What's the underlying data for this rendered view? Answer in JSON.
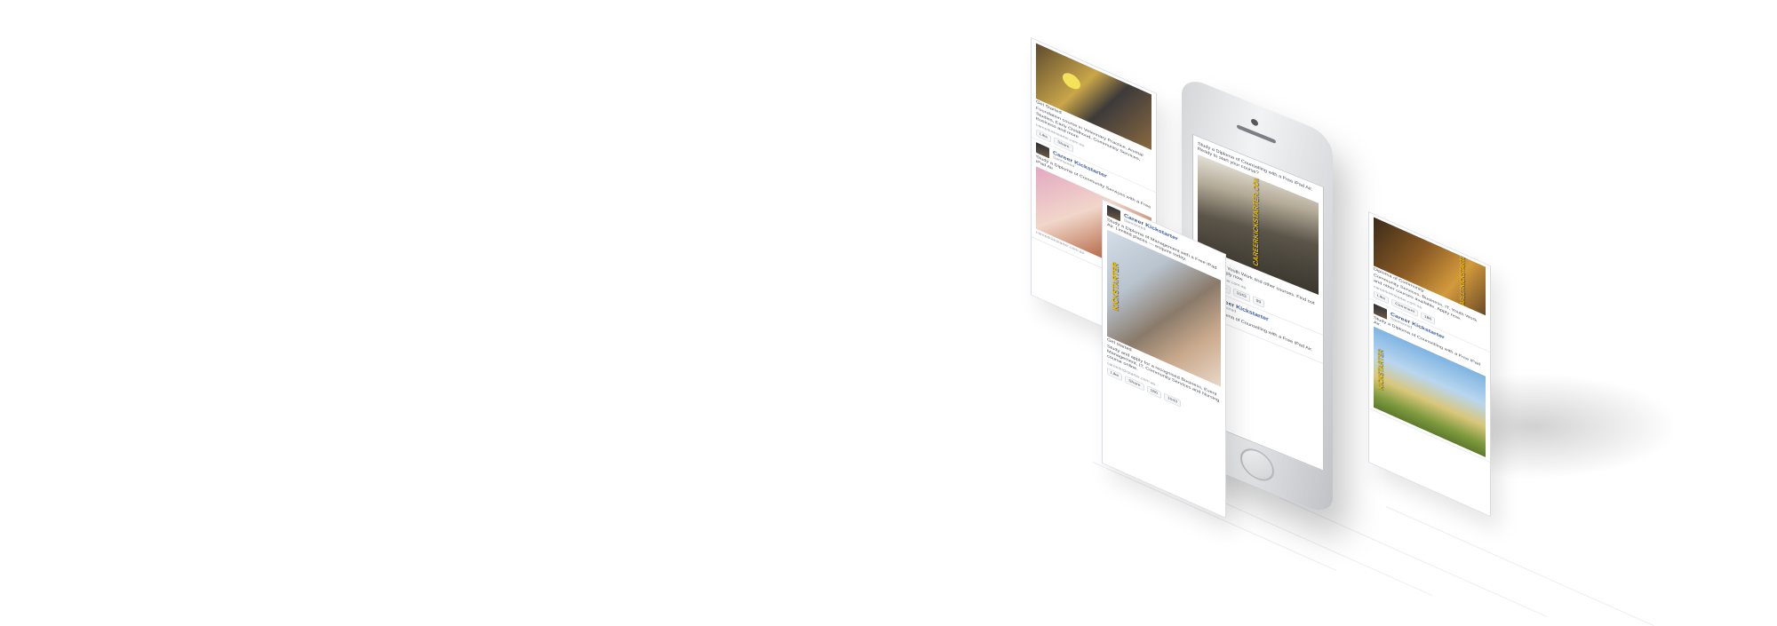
{
  "colors": {
    "background": "#ffffff",
    "link": "#3b5998",
    "brand_yellow": "#f2c300"
  },
  "cards": {
    "back_left": {
      "top_post": {
        "image_icon": "people-photo",
        "text": "Get Started",
        "body": "Foundation course in Veterinary Practice, Animal Studies, Early Childhood, Community Services, Business and more",
        "url": "careerkickstarter.com.au"
      },
      "bottom_post": {
        "name": "Career Kickstarter",
        "sub": "Sponsored",
        "body": "Study a Diploma of Community Services with a Free iPad Air",
        "url": "careerkickstarter.com.au"
      }
    },
    "front": {
      "name": "Career Kickstarter",
      "sub": "Sponsored",
      "text": "Study a Diploma of Management with a Free iPad Air. Limited places — enquire today.",
      "brand": "KICKSTARTER",
      "caption": "Get started",
      "body": "Study and apply for a recognised Business, Event Management, IT, Community Services and Nursing course online.",
      "url": "careerkickstarter.com.au"
    },
    "phone": {
      "text": "Study a Diploma of Counselling with a Free iPad Air. Ready to start your course?",
      "brand": "CAREERKICKSTARTER.COM.AU",
      "caption": "Get started",
      "body": "Business, IT, Youth Work and other courses. Find out more and apply now.",
      "url": "careerkickstarter.com.au",
      "second_name": "Career Kickstarter",
      "second_sub": "Sponsored",
      "second_text": "Study a Diploma of Counselling with a Free iPad Air."
    },
    "right": {
      "brand": "CAREERKICKSTARTER.COM.AU",
      "caption": "Diploma of Community",
      "body": "Community Services, Business, IT, Youth Work and other courses available. Apply now.",
      "url": "careerkickstarter.com.au",
      "second_name": "Career Kickstarter",
      "second_sub": "Sponsored",
      "second_text": "Study a Diploma of Counselling with a Free iPad Air.",
      "second_brand": "KICKSTARTER"
    }
  },
  "actions": {
    "like": "Like",
    "comment": "Comment",
    "share": "Share",
    "count_a": "186",
    "count_b": "1043",
    "count_c": "99"
  }
}
